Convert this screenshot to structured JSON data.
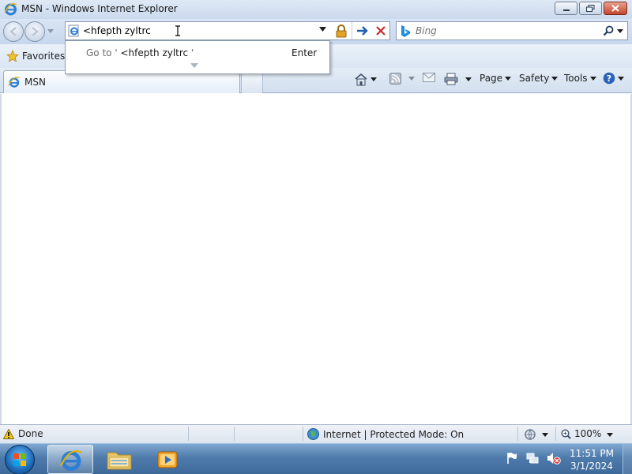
{
  "window": {
    "title": "MSN - Windows Internet Explorer"
  },
  "address_bar": {
    "value": "<hfepth zyltrc"
  },
  "search_box": {
    "placeholder": "Bing"
  },
  "autocomplete": {
    "goto_prefix": "Go to '",
    "query": " <hfepth zyltrc ",
    "goto_suffix": "'",
    "enter_label": "Enter"
  },
  "favorites": {
    "label": "Favorites"
  },
  "tab": {
    "title": "MSN"
  },
  "command_bar": {
    "page_label": "Page",
    "safety_label": "Safety",
    "tools_label": "Tools"
  },
  "status_bar": {
    "status_text": "Done",
    "zone_text": "Internet | Protected Mode: On",
    "zoom_text": "100%"
  },
  "taskbar": {
    "time": "11:51 PM",
    "date": "3/1/2024"
  },
  "icons": {
    "app": "ie-logo-icon",
    "back": "back-arrow-icon",
    "forward": "forward-arrow-icon",
    "lock": "padlock-icon",
    "go": "go-arrow-icon",
    "stop": "stop-x-icon",
    "search": "magnifier-icon",
    "home": "home-icon",
    "feeds": "rss-feed-icon",
    "mail": "mail-icon",
    "print": "printer-icon",
    "help": "help-icon"
  },
  "colors": {
    "accent": "#1f5fb1",
    "stop": "#cc2a2a",
    "lock": "#e0a526"
  }
}
